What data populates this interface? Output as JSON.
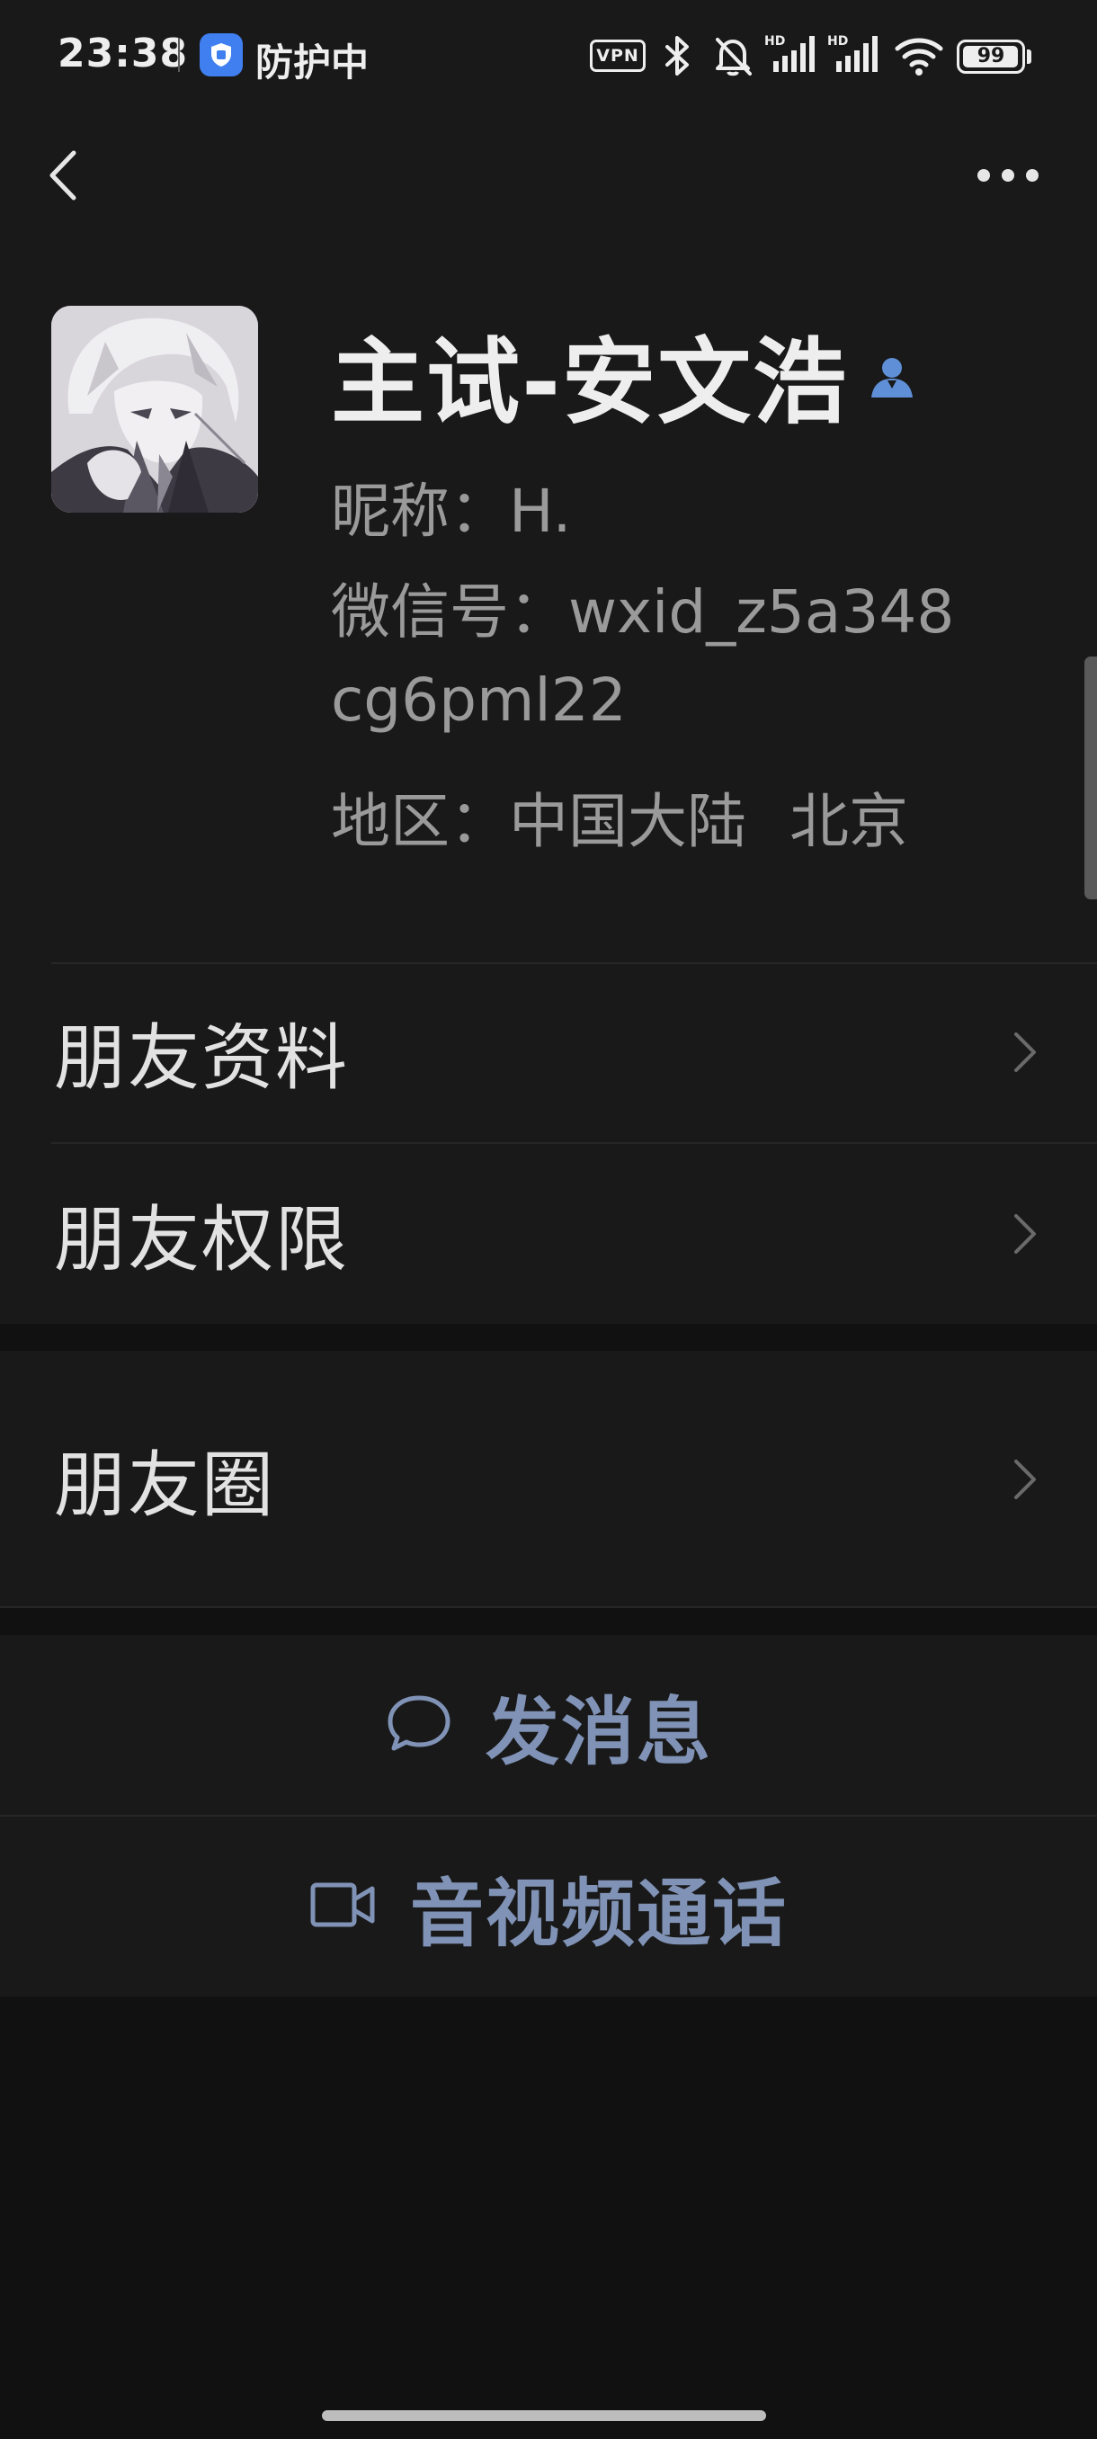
{
  "status_bar": {
    "time": "23:38",
    "protect_label": "防护中",
    "vpn_label": "VPN",
    "battery_level": "99",
    "battery_fraction": 0.99,
    "icons": [
      "shield-app-icon",
      "bluetooth-icon",
      "bell-muted-icon",
      "hd-signal-icon",
      "hd-signal-icon",
      "wifi-icon",
      "battery-icon"
    ]
  },
  "nav": {
    "back_icon": "chevron-left-icon",
    "more_icon": "more-dots-icon"
  },
  "profile": {
    "name": "主试-安文浩",
    "nickname_line": "昵称：H.",
    "wechat_id_line1": "微信号：wxid_z5a348",
    "wechat_id_line2": "cg6pml22",
    "region_label": "地区：中国大陆",
    "region_city": "北京",
    "contact_icon": "contact-person-icon"
  },
  "menu": {
    "friend_info": "朋友资料",
    "friend_permissions": "朋友权限",
    "moments": "朋友圈"
  },
  "actions": {
    "send_message": "发消息",
    "av_call": "音视频通话"
  },
  "colors": {
    "background": "#111111",
    "surface": "#191919",
    "accent_link": "#8093b6",
    "contact_icon": "#5f8fd6",
    "shield_blue": "#3f7ff0"
  }
}
